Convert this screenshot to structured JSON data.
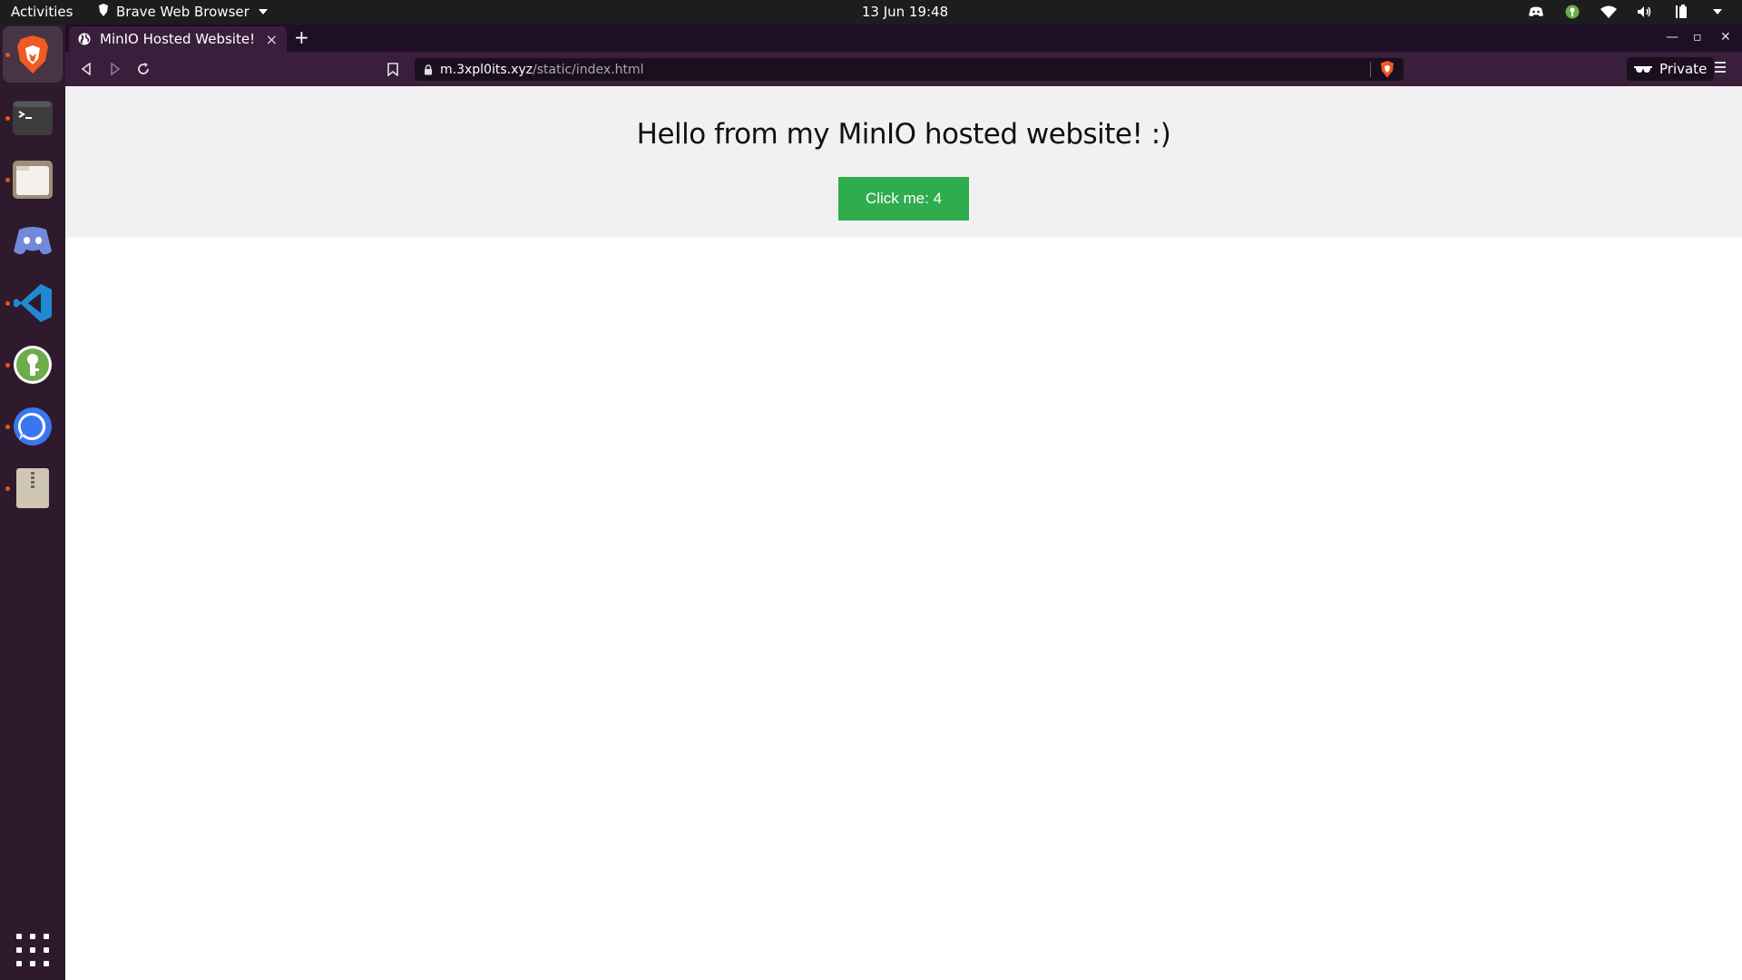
{
  "topbar": {
    "activities": "Activities",
    "app_name": "Brave Web Browser",
    "datetime": "13 Jun  19:48",
    "tray_icons": [
      "discord-tray-icon",
      "keepassxc-tray-icon",
      "wifi-icon",
      "volume-icon",
      "battery-icon",
      "system-menu-caret-icon"
    ]
  },
  "dock": {
    "items": [
      "brave-browser",
      "terminal",
      "files",
      "discord",
      "vscode",
      "keepassxc",
      "signal",
      "archive-manager"
    ],
    "show_apps": "show-applications-icon"
  },
  "browser": {
    "tab_title": "MinIO Hosted Website!",
    "tab_close": "×",
    "new_tab": "+",
    "url_host": "m.3xpl0its.xyz",
    "url_path": "/static/index.html",
    "private_label": "Private",
    "window_controls": {
      "minimize": "—",
      "maximize": "▫",
      "close": "✕"
    }
  },
  "page": {
    "heading": "Hello from my MinIO hosted website! :)",
    "button_label": "Click me: 4",
    "button_color": "#2eac4e"
  },
  "colors": {
    "topbar": "#1d1d1d",
    "dock": "#2e1a2c",
    "tabstrip": "#1e0f26",
    "toolbar": "#3a1f3d",
    "hero_bg": "#f1f1f1",
    "ubuntu_orange": "#e95420"
  }
}
